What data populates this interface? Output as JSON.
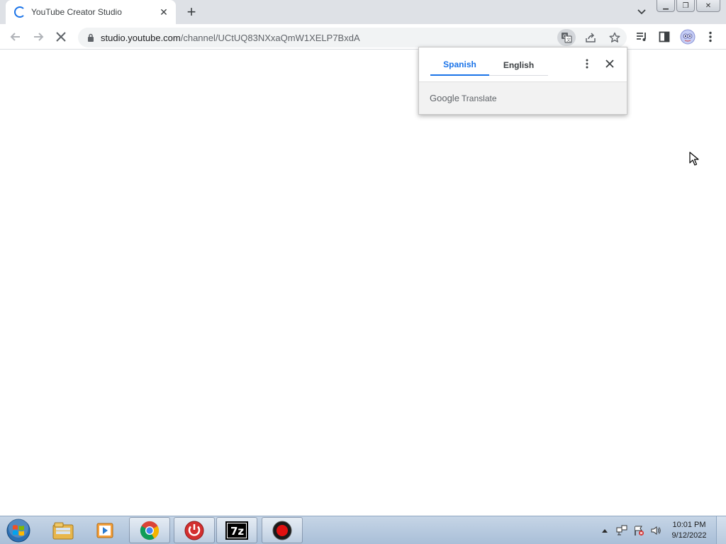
{
  "browser": {
    "tab": {
      "title": "YouTube Creator Studio",
      "close_glyph": "✕"
    },
    "new_tab_glyph": "+",
    "window_controls": {
      "minimize": "▁",
      "restore": "❐",
      "close": "✕"
    }
  },
  "toolbar": {
    "url_host": "studio.youtube.com",
    "url_path": "/channel/UCtUQ83NXxaQmW1XELP7BxdA"
  },
  "translate_popup": {
    "tabs": [
      {
        "label": "Spanish",
        "active": true
      },
      {
        "label": "English",
        "active": false
      }
    ],
    "brand": "Google",
    "product": "Translate"
  },
  "taskbar": {
    "apps": [
      "windows-explorer",
      "media-player",
      "chrome",
      "power-app",
      "7zip",
      "recorder"
    ],
    "sevenzip_label": "7z",
    "clock_time": "10:01 PM",
    "clock_date": "9/12/2022"
  },
  "colors": {
    "accent": "#1a73e8",
    "tabstrip": "#dee1e6",
    "omnibox": "#f1f3f4"
  }
}
